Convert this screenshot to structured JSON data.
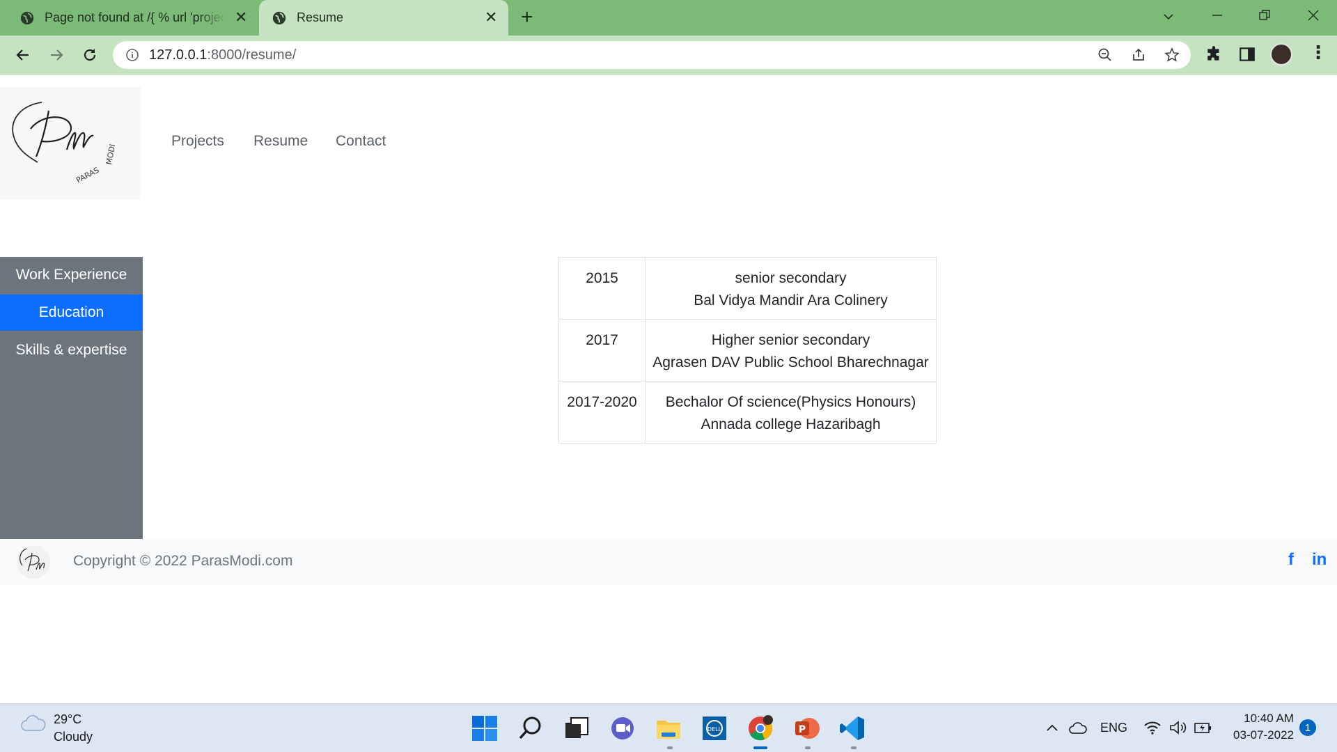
{
  "browser": {
    "tabs": [
      {
        "title": "Page not found at /{ % url 'projects' %}",
        "active": false
      },
      {
        "title": "Resume",
        "active": true
      }
    ],
    "url_host": "127.0.0.1",
    "url_rest": ":8000/resume/"
  },
  "site": {
    "logo_text": "PARAS MODI",
    "nav": [
      "Projects",
      "Resume",
      "Contact"
    ],
    "sidebar": [
      {
        "label": "Work Experience",
        "active": false
      },
      {
        "label": "Education",
        "active": true
      },
      {
        "label": "Skills & expertise",
        "active": false
      }
    ],
    "education": [
      {
        "year": "2015",
        "degree": "senior secondary",
        "school": "Bal Vidya Mandir Ara Colinery"
      },
      {
        "year": "2017",
        "degree": "Higher senior secondary",
        "school": "Agrasen DAV Public School Bharechnagar"
      },
      {
        "year": "2017-2020",
        "degree": "Bechalor Of science(Physics Honours)",
        "school": "Annada college Hazaribagh"
      }
    ],
    "footer": {
      "copyright": "Copyright © 2022 ParasModi.com",
      "social": [
        "f",
        "in"
      ]
    }
  },
  "taskbar": {
    "temperature": "29°C",
    "weather": "Cloudy",
    "language": "ENG",
    "time": "10:40 AM",
    "date": "03-07-2022",
    "notifications": "1"
  },
  "colors": {
    "tabstrip": "#7cba77",
    "toolbar": "#c5e3c1",
    "sidebar": "#6c757d",
    "active": "#0d6efd"
  }
}
